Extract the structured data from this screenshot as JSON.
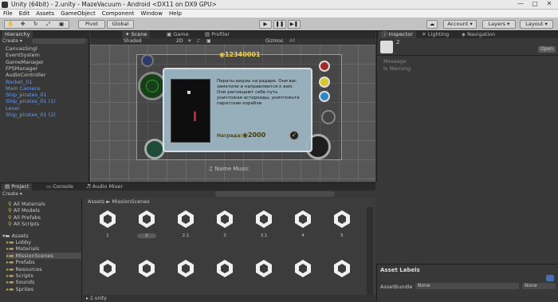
{
  "window": {
    "title": "Unity (64bit) - 2.unity - MazeVacuum - Android <DX11 on DX9 GPU>",
    "minimize": "—",
    "maximize": "▢",
    "close": "✕"
  },
  "menu": [
    "File",
    "Edit",
    "Assets",
    "GameObject",
    "Component",
    "Window",
    "Help"
  ],
  "toolbar": {
    "pivot": "Pivot",
    "global": "Global",
    "account": "Account",
    "layers": "Layers",
    "layout": "Layout"
  },
  "hierarchy": {
    "tab": "Hierarchy",
    "create": "Create",
    "items": [
      {
        "label": "CanvasSingl",
        "blue": false
      },
      {
        "label": "EventSystem",
        "blue": false
      },
      {
        "label": "GameManager",
        "blue": false
      },
      {
        "label": "FPSManager",
        "blue": false
      },
      {
        "label": "AudioController",
        "blue": false
      },
      {
        "label": "Rocket_01",
        "blue": true
      },
      {
        "label": "Main Camera",
        "blue": true
      },
      {
        "label": "Ship_pirates_01",
        "blue": true
      },
      {
        "label": "Ship_pirates_01 (1)",
        "blue": true
      },
      {
        "label": "Level",
        "blue": true
      },
      {
        "label": "Ship_pirates_01 (2)",
        "blue": true
      }
    ]
  },
  "scene": {
    "tabs": [
      "Scene",
      "Game",
      "Profiler"
    ],
    "shaded": "Shaded",
    "mode2d": "2D",
    "gizmos": "Gizmos",
    "search": "All",
    "score": "12340001",
    "dialog_text": "Пираты видны на радаре. Они вас заметили и направляются к вам. Они расчищают себе путь уничтожая астероиды, уничтожьте пиратские корабли",
    "reward_label": "Награда:",
    "reward_value": "2000",
    "music": "Name Music"
  },
  "inspector": {
    "tabs": [
      "Inspector",
      "Lighting",
      "Navigation"
    ],
    "name": "2",
    "open": "Open",
    "message": "Message",
    "is_warning": "Is Warning"
  },
  "project": {
    "tabs": [
      "Project",
      "Console",
      "Audio Mixer"
    ],
    "create": "Create",
    "favorites": [
      "All Materials",
      "All Models",
      "All Prefabs",
      "All Scripts"
    ],
    "assets_root": "Assets",
    "folders": [
      "Lobby",
      "Materials",
      "MissionScenes",
      "Prefabs",
      "Resources",
      "Scripts",
      "Sounds",
      "Sprites"
    ],
    "breadcrumb_root": "Assets",
    "breadcrumb_sep": "►",
    "breadcrumb_leaf": "MissionScenes",
    "scenes": [
      "1",
      "2",
      "2.1",
      "3",
      "3.1",
      "4",
      "5"
    ],
    "footer_file": "2.unity"
  },
  "asset_labels": {
    "title": "Asset Labels",
    "bundle_label": "AssetBundle",
    "bundle_value": "None",
    "variant_value": "None"
  },
  "colors": {
    "accent": "#4a6fb0",
    "dialog_bg": "#9cb4c2",
    "gold": "#f5d13c"
  }
}
